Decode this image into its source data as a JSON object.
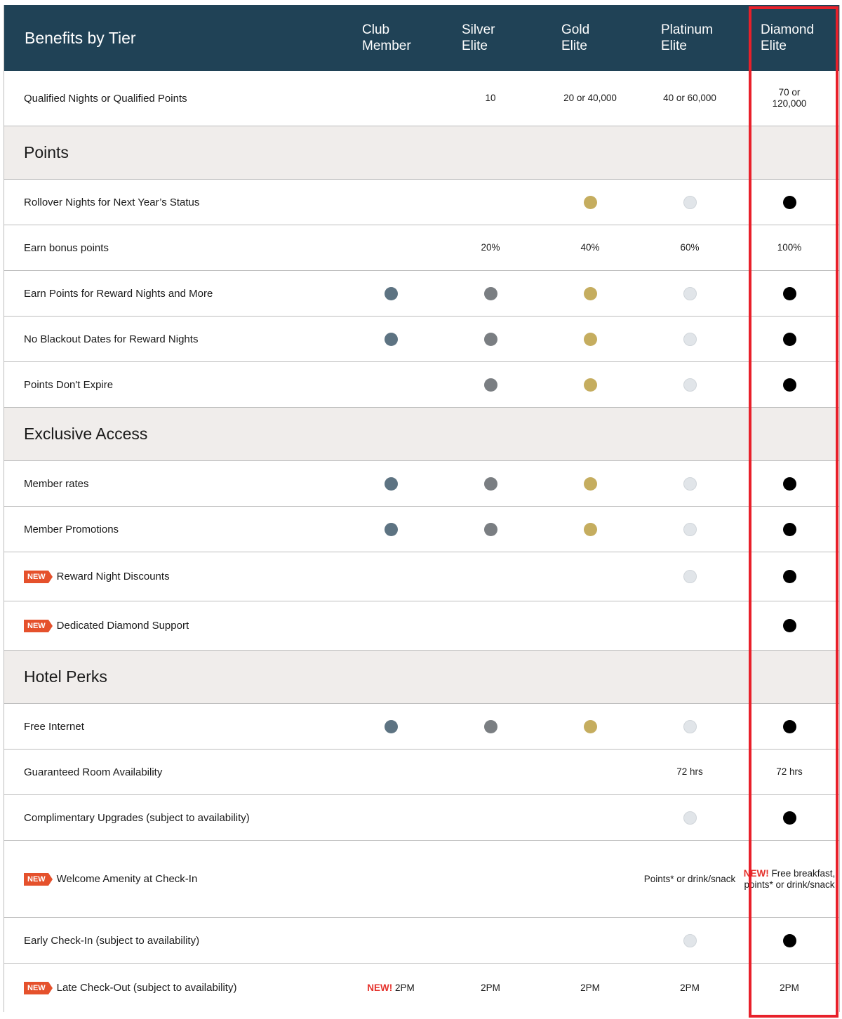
{
  "header": {
    "title": "Benefits by Tier",
    "tiers": [
      {
        "line1": "Club",
        "line2": "Member"
      },
      {
        "line1": "Silver",
        "line2": "Elite"
      },
      {
        "line1": "Gold",
        "line2": "Elite"
      },
      {
        "line1": "Platinum",
        "line2": "Elite"
      },
      {
        "line1": "Diamond",
        "line2": "Elite"
      }
    ]
  },
  "badge_label": "NEW",
  "new_prefix": "NEW!",
  "qualification": {
    "label": "Qualified Nights or Qualified Points",
    "values": [
      "",
      "10",
      "20 or 40,000",
      "40 or 60,000",
      "70 or 120,000"
    ]
  },
  "sections": [
    {
      "title": "Points",
      "rows": [
        {
          "label": "Rollover Nights for Next Year’s Status",
          "new": false,
          "cells": [
            "",
            "",
            "dot",
            "dot",
            "dot"
          ]
        },
        {
          "label": "Earn bonus points",
          "new": false,
          "cells": [
            "",
            "20%",
            "40%",
            "60%",
            "100%"
          ]
        },
        {
          "label": "Earn Points for Reward Nights and More",
          "new": false,
          "cells": [
            "dot",
            "dot",
            "dot",
            "dot",
            "dot"
          ]
        },
        {
          "label": "No Blackout Dates for Reward Nights",
          "new": false,
          "cells": [
            "dot",
            "dot",
            "dot",
            "dot",
            "dot"
          ]
        },
        {
          "label": "Points Don't Expire",
          "new": false,
          "cells": [
            "",
            "dot",
            "dot",
            "dot",
            "dot"
          ]
        }
      ]
    },
    {
      "title": "Exclusive Access",
      "rows": [
        {
          "label": "Member rates",
          "new": false,
          "cells": [
            "dot",
            "dot",
            "dot",
            "dot",
            "dot"
          ]
        },
        {
          "label": "Member Promotions",
          "new": false,
          "cells": [
            "dot",
            "dot",
            "dot",
            "dot",
            "dot"
          ]
        },
        {
          "label": "Reward Night Discounts",
          "new": true,
          "cells": [
            "",
            "",
            "",
            "dot",
            "dot"
          ]
        },
        {
          "label": "Dedicated Diamond Support",
          "new": true,
          "cells": [
            "",
            "",
            "",
            "",
            "dot"
          ]
        }
      ]
    },
    {
      "title": "Hotel Perks",
      "rows": [
        {
          "label": "Free Internet",
          "new": false,
          "cells": [
            "dot",
            "dot",
            "dot",
            "dot",
            "dot"
          ]
        },
        {
          "label": "Guaranteed Room Availability",
          "new": false,
          "cells": [
            "",
            "",
            "",
            "72 hrs",
            "72 hrs"
          ]
        },
        {
          "label": "Complimentary Upgrades (subject to availability)",
          "new": false,
          "cells": [
            "",
            "",
            "",
            "dot",
            "dot"
          ]
        },
        {
          "label": "Welcome Amenity at Check-In",
          "new": true,
          "cells": [
            "",
            "",
            "",
            "Points* or drink/snack",
            "NEW!|Free breakfast, points* or drink/snack"
          ]
        },
        {
          "label": "Early Check-In (subject to availability)",
          "new": false,
          "cells": [
            "",
            "",
            "",
            "dot",
            "dot"
          ]
        },
        {
          "label": "Late Check-Out (subject to availability)",
          "new": true,
          "cells": [
            "NEW!|2PM",
            "2PM",
            "2PM",
            "2PM",
            "2PM"
          ]
        }
      ]
    }
  ],
  "tier_colors": {
    "club": "#5d7382",
    "silver": "#7a7e82",
    "gold": "#c5ad5f",
    "platinum": "#e1e5e9",
    "diamond": "#000000"
  },
  "highlight": {
    "column": "Diamond Elite",
    "color": "#e8202a"
  }
}
